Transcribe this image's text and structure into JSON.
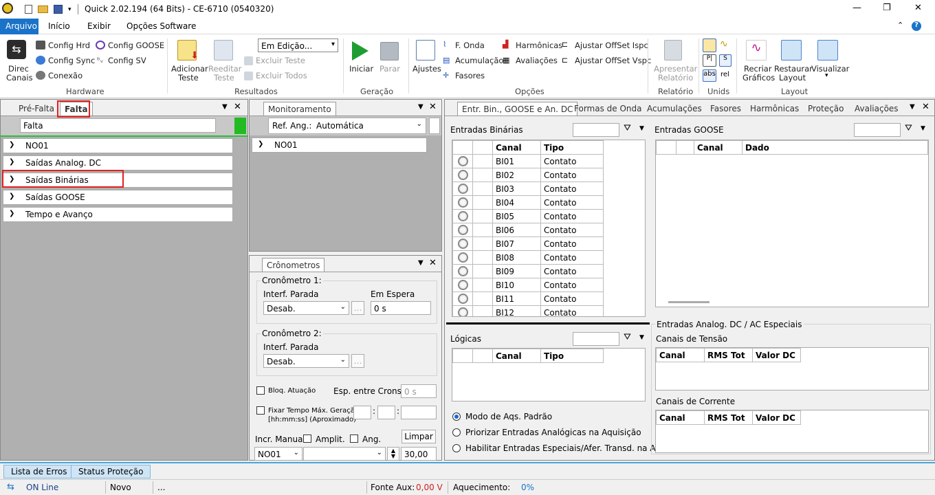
{
  "window": {
    "title": "Quick 2.02.194 (64 Bits) - CE-6710 (0540320)"
  },
  "menu": {
    "arquivo": "Arquivo",
    "inicio": "Início",
    "exibir": "Exibir",
    "opcoes": "Opções Software",
    "help": "?"
  },
  "ribbon": {
    "direc": "Direc",
    "canais": "Canais",
    "config_hrd": "Config Hrd",
    "config_sync": "Config Sync",
    "conexao": "Conexão",
    "config_goose": "Config GOOSE",
    "config_sv": "Config SV",
    "hardware": "Hardware",
    "adicionar": "Adicionar",
    "teste": "Teste",
    "reeditar": "Reeditar",
    "teste2": "Teste",
    "edicao": "Em Edição...",
    "excluir_teste": "Excluir Teste",
    "excluir_todos": "Excluir Todos",
    "resultados": "Resultados",
    "iniciar": "Iniciar",
    "parar": "Parar",
    "geracao": "Geração",
    "ajustes": "Ajustes",
    "fonda": "F. Onda",
    "acumulacao": "Acumulação",
    "fasores": "Fasores",
    "harmonicas": "Harmônicas",
    "avaliacoes": "Avaliações",
    "offset_ispc": "Ajustar OffSet Ispc",
    "offset_vspc": "Ajustar OffSet Vspc",
    "opcoes": "Opções",
    "apresentar": "Apresentar",
    "relatorio": "Relatório",
    "relatorio_grp": "Relatório",
    "unids": "Unids",
    "abs": "abs",
    "rel": "rel",
    "recriar": "Recriar",
    "graficos": "Gráficos",
    "restaurar": "Restaurar",
    "layout": "Layout",
    "visualizar": "Visualizar",
    "layout_grp": "Layout"
  },
  "left": {
    "tab1": "Pré-Falta",
    "tab2": "Falta",
    "field": "Falta",
    "items": [
      "NO01",
      "Saídas Analog. DC",
      "Saídas Binárias",
      "Saídas GOOSE",
      "Tempo e Avanço"
    ]
  },
  "middle": {
    "tab": "Monitoramento",
    "ref_label": "Ref. Ang.:",
    "ref_value": "Automática",
    "item": "NO01"
  },
  "crono": {
    "tab": "Crônometros",
    "c1": "Cronômetro 1:",
    "interf1": "Interf. Parada",
    "desab1": "Desab.",
    "espera": "Em Espera",
    "espera_val": "0 s",
    "c2": "Cronômetro 2:",
    "interf2": "Interf. Parada",
    "desab2": "Desab.",
    "bloq": "Bloq. Atuação",
    "esp_crons": "Esp. entre Crons.:",
    "esp_val": "0 s",
    "fixar": "Fixar Tempo Máx. Geração:",
    "fixar2": "[hh:mm:ss] (Aproximado)",
    "incr": "Incr. Manual",
    "amplit": "Amplit.",
    "ang": "Ang.",
    "limpar": "Limpar",
    "no01": "NO01",
    "step": "30,00"
  },
  "right": {
    "tabs": [
      "Entr. Bin., GOOSE e An. DC",
      "Formas de Onda",
      "Acumulações",
      "Fasores",
      "Harmônicas",
      "Proteção",
      "Avaliações"
    ],
    "ent_bin": "Entradas Binárias",
    "ent_goose": "Entradas GOOSE",
    "col_canal": "Canal",
    "col_tipo": "Tipo",
    "col_dado": "Dado",
    "bi_rows": [
      [
        "BI01",
        "Contato"
      ],
      [
        "BI02",
        "Contato"
      ],
      [
        "BI03",
        "Contato"
      ],
      [
        "BI04",
        "Contato"
      ],
      [
        "BI05",
        "Contato"
      ],
      [
        "BI06",
        "Contato"
      ],
      [
        "BI07",
        "Contato"
      ],
      [
        "BI08",
        "Contato"
      ],
      [
        "BI09",
        "Contato"
      ],
      [
        "BI10",
        "Contato"
      ],
      [
        "BI11",
        "Contato"
      ],
      [
        "BI12",
        "Contato"
      ]
    ],
    "logicas": "Lógicas",
    "analog": "Entradas Analog. DC / AC Especiais",
    "tensao": "Canais de Tensão",
    "corrente": "Canais de Corrente",
    "rms": "RMS Tot",
    "valor": "Valor DC",
    "modo1": "Modo de Aqs. Padrão",
    "modo2": "Priorizar Entradas Analógicas na Aquisição",
    "modo3": "Habilitar Entradas Especiais/Afer. Transd. na Aqs."
  },
  "bottom": {
    "erros": "Lista de Erros",
    "status": "Status Proteção"
  },
  "status": {
    "online": "ON Line",
    "novo": "Novo",
    "dots": "...",
    "fonte": "Fonte Aux:",
    "fonte_val": "0,00 V",
    "aquec": "Aquecimento:",
    "aquec_val": "0%"
  },
  "colors": {
    "accent": "#1a73c8",
    "red": "#e02020",
    "green": "#22bb22"
  }
}
